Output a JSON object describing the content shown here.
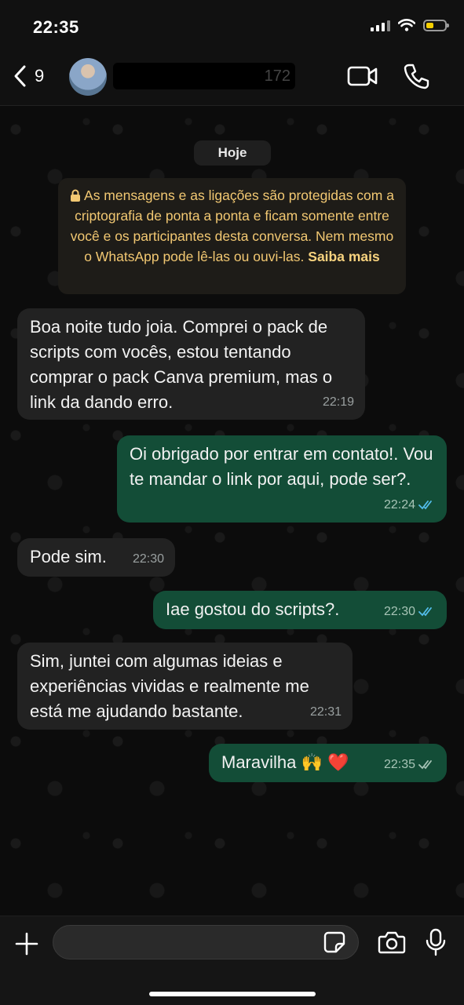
{
  "status_bar": {
    "time": "22:35"
  },
  "header": {
    "back_count": "9",
    "contact_name": "172"
  },
  "chat": {
    "date_label": "Hoje",
    "encryption_notice": "As mensagens e as ligações são protegidas com a criptografia de ponta a ponta e ficam somente entre você e os participantes desta conversa. Nem mesmo o WhatsApp pode lê-las ou ouvi-las.",
    "encryption_link": "Saiba mais",
    "messages": [
      {
        "direction": "incoming",
        "text": "Boa noite tudo joia. Comprei o pack de scripts com vocês, estou tentando comprar o pack Canva premium, mas o link da dando erro.",
        "time": "22:19"
      },
      {
        "direction": "outgoing",
        "text": "Oi obrigado por entrar em contato!. Vou te mandar o link por aqui, pode ser?.",
        "time": "22:24",
        "read": true
      },
      {
        "direction": "incoming",
        "text": "Pode sim.",
        "time": "22:30"
      },
      {
        "direction": "outgoing",
        "text": "Iae gostou do  scripts?.",
        "time": "22:30",
        "read": true
      },
      {
        "direction": "incoming",
        "text": "Sim, juntei com algumas ideias e experiências vividas e realmente me está me ajudando bastante.",
        "time": "22:31"
      },
      {
        "direction": "outgoing",
        "text": "Maravilha 🙌 ❤️",
        "time": "22:35",
        "read": false
      }
    ]
  },
  "composer": {
    "placeholder": ""
  },
  "icons": {
    "back": "chevron-left-icon",
    "video": "video-camera-icon",
    "call": "phone-icon",
    "plus": "plus-icon",
    "sticker": "sticker-icon",
    "camera": "camera-icon",
    "mic": "microphone-icon",
    "read_ticks": "double-check-icon"
  },
  "colors": {
    "incoming_bubble": "#222222",
    "outgoing_bubble": "#134d37",
    "read_ticks": "#53bdeb",
    "delivered_ticks": "#a7c4b6",
    "encryption_text": "#f2c872",
    "battery_fill": "#f5cf00"
  }
}
